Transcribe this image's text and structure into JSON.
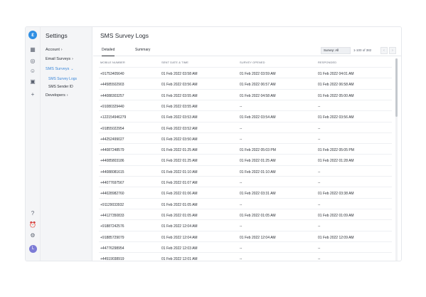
{
  "rail": {
    "logo": "ε",
    "avatar": "L"
  },
  "sidebar": {
    "title": "Settings",
    "items": [
      {
        "label": "Account"
      },
      {
        "label": "Email Surveys"
      },
      {
        "label": "SMS Surveys"
      },
      {
        "label": "Developers"
      }
    ],
    "subitems": [
      {
        "label": "SMS Survey Logs"
      },
      {
        "label": "SMS Sender ID"
      }
    ]
  },
  "main": {
    "title": "SMS Survey Logs",
    "tabs": [
      {
        "label": "Detailed"
      },
      {
        "label": "Summary"
      }
    ],
    "filter": "Survey: All",
    "page_info": "1-100 of 382",
    "columns": [
      "MOBILE NUMBER",
      "SENT DATE & TIME",
      "SURVEY OPENED",
      "RESPONDED"
    ],
    "rows": [
      [
        "+91753405640",
        "01 Feb 2022 03:58 AM",
        "01 Feb 2022 03:59 AM",
        "01 Feb 2022 04:01 AM"
      ],
      [
        "+44585502903",
        "01 Feb 2022 03:56 AM",
        "01 Feb 2022 06:57 AM",
        "01 Feb 2022 06:58 AM"
      ],
      [
        "+44088303257",
        "01 Feb 2022 03:55 AM",
        "01 Feb 2022 04:58 AM",
        "01 Feb 2022 05:00 AM"
      ],
      [
        "+91080329440",
        "01 Feb 2022 03:55 AM",
        "--",
        "--"
      ],
      [
        "+122154946279",
        "01 Feb 2022 03:53 AM",
        "01 Feb 2022 03:54 AM",
        "01 Feb 2022 03:56 AM"
      ],
      [
        "+91855022954",
        "01 Feb 2022 03:52 AM",
        "--",
        "--"
      ],
      [
        "+44252499027",
        "01 Feb 2022 03:50 AM",
        "--",
        "--"
      ],
      [
        "+44087248579",
        "01 Feb 2022 01:25 AM",
        "01 Feb 2022 05:03 PM",
        "01 Feb 2022 05:05 PM"
      ],
      [
        "+44085803186",
        "01 Feb 2022 01:25 AM",
        "01 Feb 2022 01:25 AM",
        "01 Feb 2022 01:28 AM"
      ],
      [
        "+44088081615",
        "01 Feb 2022 01:10 AM",
        "01 Feb 2022 01:10 AM",
        "--"
      ],
      [
        "+44077697567",
        "01 Feb 2022 01:07 AM",
        "--",
        "--"
      ],
      [
        "+44028982760",
        "01 Feb 2022 01:06 AM",
        "01 Feb 2022 03:31 AM",
        "01 Feb 2022 03:38 AM"
      ],
      [
        "+91129033932",
        "01 Feb 2022 01:05 AM",
        "--",
        "--"
      ],
      [
        "+44127350833",
        "01 Feb 2022 01:05 AM",
        "01 Feb 2022 01:05 AM",
        "01 Feb 2022 01:09 AM"
      ],
      [
        "+91887242576",
        "01 Feb 2022 12:04 AM",
        "--",
        "--"
      ],
      [
        "+91885729079",
        "01 Feb 2022 12:04 AM",
        "01 Feb 2022 12:04 AM",
        "01 Feb 2022 12:09 AM"
      ],
      [
        "+44776298954",
        "01 Feb 2022 12:03 AM",
        "--",
        "--"
      ],
      [
        "+44519038919",
        "01 Feb 2022 12:01 AM",
        "--",
        "--"
      ]
    ]
  }
}
